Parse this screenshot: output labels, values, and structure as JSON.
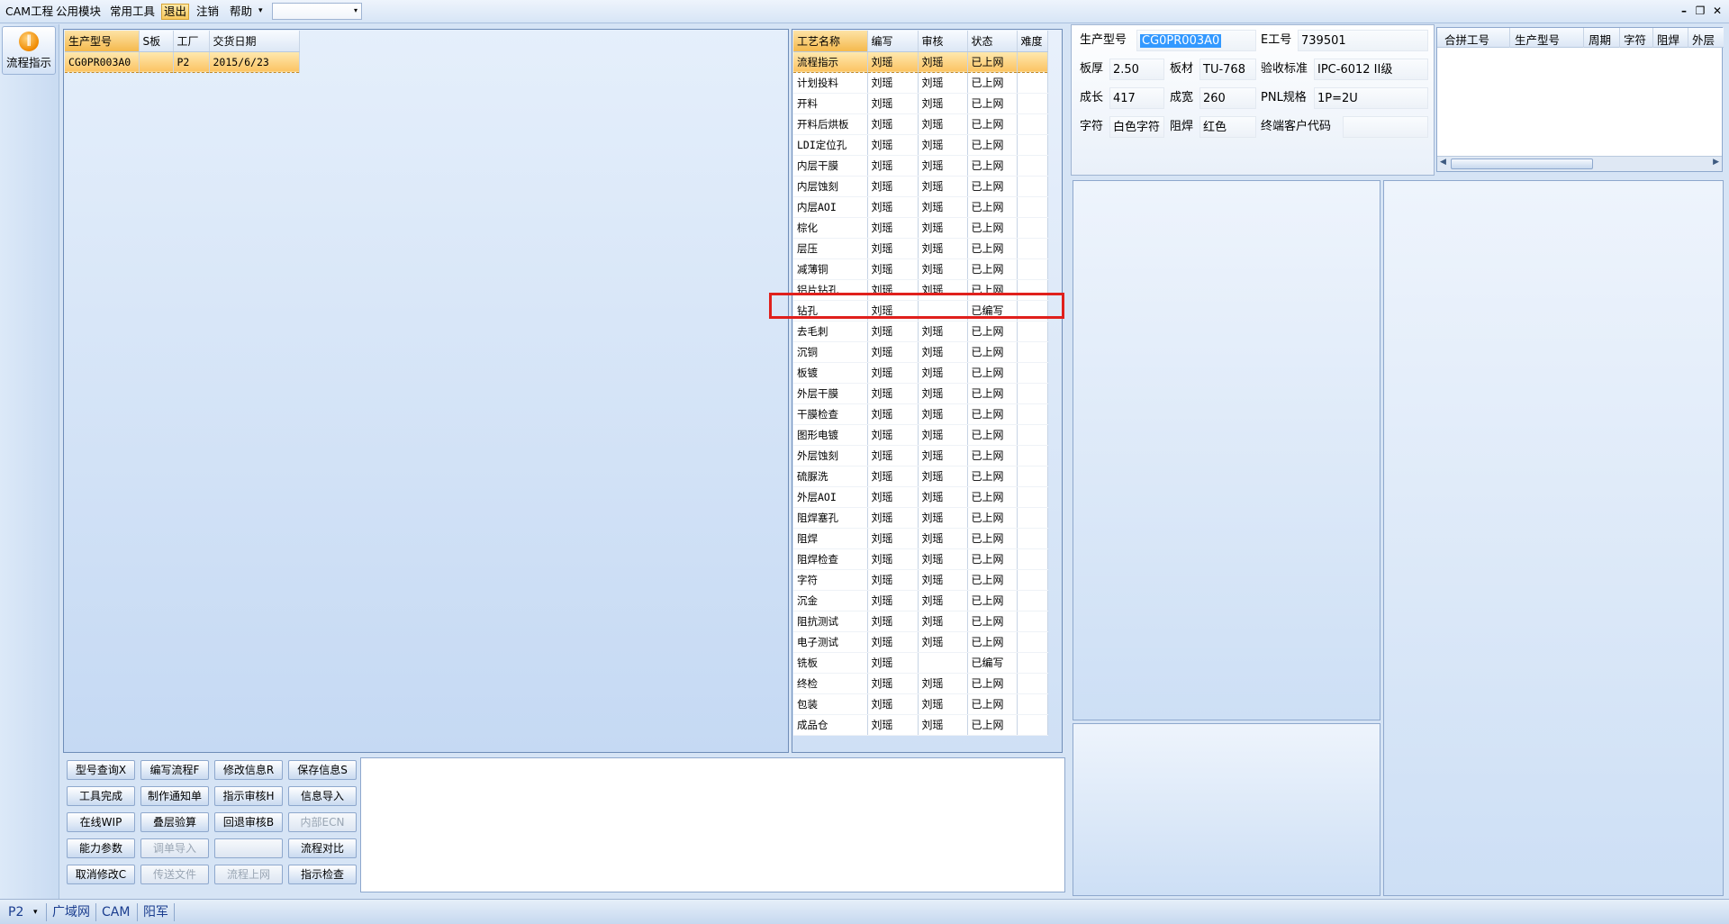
{
  "menu": {
    "items": [
      "CAM工程",
      "公用模块",
      "常用工具",
      "退出",
      "注销",
      "帮助"
    ],
    "active_item": "退出",
    "dropdown_arrow": "▾",
    "combo_value": ""
  },
  "window_controls": [
    "–",
    "❐",
    "✕"
  ],
  "sidebar": {
    "flow_button_label": "流程指示",
    "flow_button_icon": "pause-circle-icon"
  },
  "orders": {
    "columns": [
      "生产型号",
      "S板",
      "工厂",
      "交货日期"
    ],
    "rows": [
      [
        "CG0PR003A0",
        "",
        "P2",
        "2015/6/23"
      ]
    ],
    "selected_row": 0
  },
  "process": {
    "columns": [
      "工艺名称",
      "编写",
      "审核",
      "状态",
      "难度"
    ],
    "rows": [
      [
        "流程指示",
        "刘瑶",
        "刘瑶",
        "已上网",
        ""
      ],
      [
        "计划投料",
        "刘瑶",
        "刘瑶",
        "已上网",
        ""
      ],
      [
        "开料",
        "刘瑶",
        "刘瑶",
        "已上网",
        ""
      ],
      [
        "开料后烘板",
        "刘瑶",
        "刘瑶",
        "已上网",
        ""
      ],
      [
        "LDI定位孔",
        "刘瑶",
        "刘瑶",
        "已上网",
        ""
      ],
      [
        "内层干膜",
        "刘瑶",
        "刘瑶",
        "已上网",
        ""
      ],
      [
        "内层蚀刻",
        "刘瑶",
        "刘瑶",
        "已上网",
        ""
      ],
      [
        "内层AOI",
        "刘瑶",
        "刘瑶",
        "已上网",
        ""
      ],
      [
        "棕化",
        "刘瑶",
        "刘瑶",
        "已上网",
        ""
      ],
      [
        "层压",
        "刘瑶",
        "刘瑶",
        "已上网",
        ""
      ],
      [
        "减薄铜",
        "刘瑶",
        "刘瑶",
        "已上网",
        ""
      ],
      [
        "铝片钻孔",
        "刘瑶",
        "刘瑶",
        "已上网",
        ""
      ],
      [
        "钻孔",
        "刘瑶",
        "",
        "已编写",
        ""
      ],
      [
        "去毛刺",
        "刘瑶",
        "刘瑶",
        "已上网",
        ""
      ],
      [
        "沉铜",
        "刘瑶",
        "刘瑶",
        "已上网",
        ""
      ],
      [
        "板镀",
        "刘瑶",
        "刘瑶",
        "已上网",
        ""
      ],
      [
        "外层干膜",
        "刘瑶",
        "刘瑶",
        "已上网",
        ""
      ],
      [
        "干膜检查",
        "刘瑶",
        "刘瑶",
        "已上网",
        ""
      ],
      [
        "图形电镀",
        "刘瑶",
        "刘瑶",
        "已上网",
        ""
      ],
      [
        "外层蚀刻",
        "刘瑶",
        "刘瑶",
        "已上网",
        ""
      ],
      [
        "硫脲洗",
        "刘瑶",
        "刘瑶",
        "已上网",
        ""
      ],
      [
        "外层AOI",
        "刘瑶",
        "刘瑶",
        "已上网",
        ""
      ],
      [
        "阻焊塞孔",
        "刘瑶",
        "刘瑶",
        "已上网",
        ""
      ],
      [
        "阻焊",
        "刘瑶",
        "刘瑶",
        "已上网",
        ""
      ],
      [
        "阻焊检查",
        "刘瑶",
        "刘瑶",
        "已上网",
        ""
      ],
      [
        "字符",
        "刘瑶",
        "刘瑶",
        "已上网",
        ""
      ],
      [
        "沉金",
        "刘瑶",
        "刘瑶",
        "已上网",
        ""
      ],
      [
        "阻抗测试",
        "刘瑶",
        "刘瑶",
        "已上网",
        ""
      ],
      [
        "电子测试",
        "刘瑶",
        "刘瑶",
        "已上网",
        ""
      ],
      [
        "铣板",
        "刘瑶",
        "",
        "已编写",
        ""
      ],
      [
        "终检",
        "刘瑶",
        "刘瑶",
        "已上网",
        ""
      ],
      [
        "包装",
        "刘瑶",
        "刘瑶",
        "已上网",
        ""
      ],
      [
        "成品仓",
        "刘瑶",
        "刘瑶",
        "已上网",
        ""
      ]
    ],
    "selected_row": 0,
    "highlighted_row": 12
  },
  "buttons": [
    [
      "型号查询X",
      "编写流程F",
      "修改信息R",
      "保存信息S"
    ],
    [
      "工具完成",
      "制作通知单",
      "指示审核H",
      "信息导入"
    ],
    [
      "在线WIP",
      "叠层验算",
      "回退审核B",
      "内部ECN"
    ],
    [
      "能力参数",
      "调单导入",
      "",
      "流程对比"
    ],
    [
      "取消修改C",
      "传送文件",
      "流程上网",
      "指示检查"
    ]
  ],
  "disabled_buttons": [
    "内部ECN",
    "调单导入",
    "传送文件",
    "流程上网",
    ""
  ],
  "info": {
    "fields": [
      {
        "label": "生产型号",
        "value": "CG0PR003A0"
      },
      {
        "label": "E工号",
        "value": "739501"
      },
      {
        "label": "板厚",
        "value": "2.50"
      },
      {
        "label": "板材",
        "value": "TU-768"
      },
      {
        "label": "验收标准",
        "value": "IPC-6012 II级"
      },
      {
        "label": "成长",
        "value": "417"
      },
      {
        "label": "成宽",
        "value": "260"
      },
      {
        "label": "PNL规格",
        "value": "1P=2U"
      },
      {
        "label": "字符",
        "value": "白色字符"
      },
      {
        "label": "阻焊",
        "value": "红色"
      },
      {
        "label": "终端客户代码",
        "value": ""
      }
    ]
  },
  "merge": {
    "columns": [
      "合拼工号",
      "生产型号",
      "周期",
      "字符",
      "阻焊",
      "外层"
    ]
  },
  "status": {
    "items": [
      "P2",
      "广域网",
      "CAM",
      "阳军"
    ],
    "dropdown_arrow": "▾"
  },
  "colors": {
    "highlight_box": "#e0201c",
    "selected_row": "#fbc363",
    "menu_active": "#f7c85d",
    "text_selection": "#3399ff"
  }
}
